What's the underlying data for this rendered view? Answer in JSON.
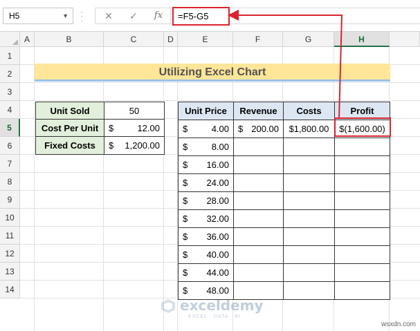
{
  "formula_bar": {
    "name_box": "H5",
    "formula": "=F5-G5",
    "icons": [
      "close-icon",
      "check-icon",
      "fx-icon"
    ]
  },
  "columns": [
    "A",
    "B",
    "C",
    "D",
    "E",
    "F",
    "G",
    "H"
  ],
  "active_column": "H",
  "rows": [
    "1",
    "2",
    "3",
    "4",
    "5",
    "6",
    "7",
    "8",
    "9",
    "10",
    "11",
    "12",
    "13",
    "14"
  ],
  "active_row": "5",
  "title": "Utilizing Excel Chart",
  "inputs": [
    {
      "label": "Unit Sold",
      "currency": "",
      "value": "50"
    },
    {
      "label": "Cost Per Unit",
      "currency": "$",
      "value": "12.00"
    },
    {
      "label": "Fixed Costs",
      "currency": "$",
      "value": "1,200.00"
    }
  ],
  "table": {
    "headers": [
      "Unit Price",
      "Revenue",
      "Costs",
      "Profit"
    ],
    "rows": [
      {
        "unit_price": "4.00",
        "revenue": "200.00",
        "costs": "$1,800.00",
        "profit": "$(1,600.00)"
      },
      {
        "unit_price": "8.00",
        "revenue": "",
        "costs": "",
        "profit": ""
      },
      {
        "unit_price": "16.00",
        "revenue": "",
        "costs": "",
        "profit": ""
      },
      {
        "unit_price": "24.00",
        "revenue": "",
        "costs": "",
        "profit": ""
      },
      {
        "unit_price": "28.00",
        "revenue": "",
        "costs": "",
        "profit": ""
      },
      {
        "unit_price": "32.00",
        "revenue": "",
        "costs": "",
        "profit": ""
      },
      {
        "unit_price": "36.00",
        "revenue": "",
        "costs": "",
        "profit": ""
      },
      {
        "unit_price": "40.00",
        "revenue": "",
        "costs": "",
        "profit": ""
      },
      {
        "unit_price": "44.00",
        "revenue": "",
        "costs": "",
        "profit": ""
      },
      {
        "unit_price": "48.00",
        "revenue": "",
        "costs": "",
        "profit": ""
      }
    ],
    "currency_symbol": "$"
  },
  "watermark": {
    "name": "exceldemy",
    "tagline": "EXCEL · DATA · BI"
  },
  "site": "wsxdn.com",
  "colors": {
    "highlight": "#d9232d",
    "title_fill": "#ffe699",
    "label_fill": "#e2efda",
    "header_fill": "#dde6f3"
  }
}
